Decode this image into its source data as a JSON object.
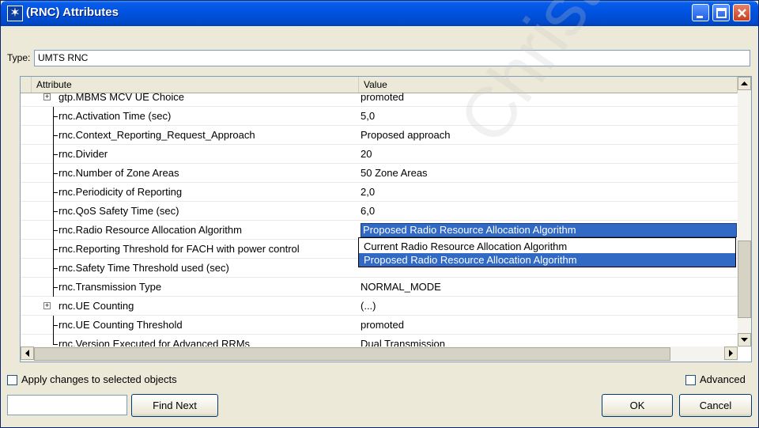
{
  "window": {
    "title": "(RNC) Attributes"
  },
  "type": {
    "label": "Type:",
    "value": "UMTS RNC"
  },
  "table": {
    "headers": [
      "Attribute",
      "Value"
    ],
    "rows": [
      {
        "attribute": "gtp.MBMS MCV UE Choice",
        "value": "promoted",
        "expandable": true
      },
      {
        "attribute": "rnc.Activation Time (sec)",
        "value": "5,0",
        "expandable": false
      },
      {
        "attribute": "rnc.Context_Reporting_Request_Approach",
        "value": "Proposed approach",
        "expandable": false
      },
      {
        "attribute": "rnc.Divider",
        "value": "20",
        "expandable": false
      },
      {
        "attribute": "rnc.Number of Zone Areas",
        "value": "50 Zone Areas",
        "expandable": false
      },
      {
        "attribute": "rnc.Periodicity of Reporting",
        "value": "2,0",
        "expandable": false
      },
      {
        "attribute": "rnc.QoS Safety Time (sec)",
        "value": "6,0",
        "expandable": false
      },
      {
        "attribute": "rnc.Radio Resource Allocation Algorithm",
        "value": "Proposed Radio Resource Allocation Algorithm",
        "expandable": false
      },
      {
        "attribute": "rnc.Reporting Threshold for FACH with power control",
        "value": "",
        "expandable": false
      },
      {
        "attribute": "rnc.Safety Time Threshold used (sec)",
        "value": "",
        "expandable": false
      },
      {
        "attribute": "rnc.Transmission Type",
        "value": "NORMAL_MODE",
        "expandable": false
      },
      {
        "attribute": "rnc.UE Counting",
        "value": "(...)",
        "expandable": true
      },
      {
        "attribute": "rnc.UE Counting Threshold",
        "value": "promoted",
        "expandable": false
      },
      {
        "attribute": "rnc.Version Executed for Advanced RRMs",
        "value": "Dual Transmission",
        "expandable": false
      }
    ]
  },
  "dropdown": {
    "options": [
      "Current Radio Resource Allocation Algorithm",
      "Proposed Radio Resource Allocation Algorithm"
    ],
    "highlighted": "Proposed Radio Resource Allocation Algorithm"
  },
  "footer": {
    "apply_label": "Apply changes to selected objects",
    "advanced_label": "Advanced",
    "find_next_label": "Find Next",
    "find_value": "",
    "ok_label": "OK",
    "cancel_label": "Cancel"
  },
  "watermark": "Christop",
  "colors": {
    "selection": "#316ac5",
    "title_bar": "#0054e3"
  }
}
